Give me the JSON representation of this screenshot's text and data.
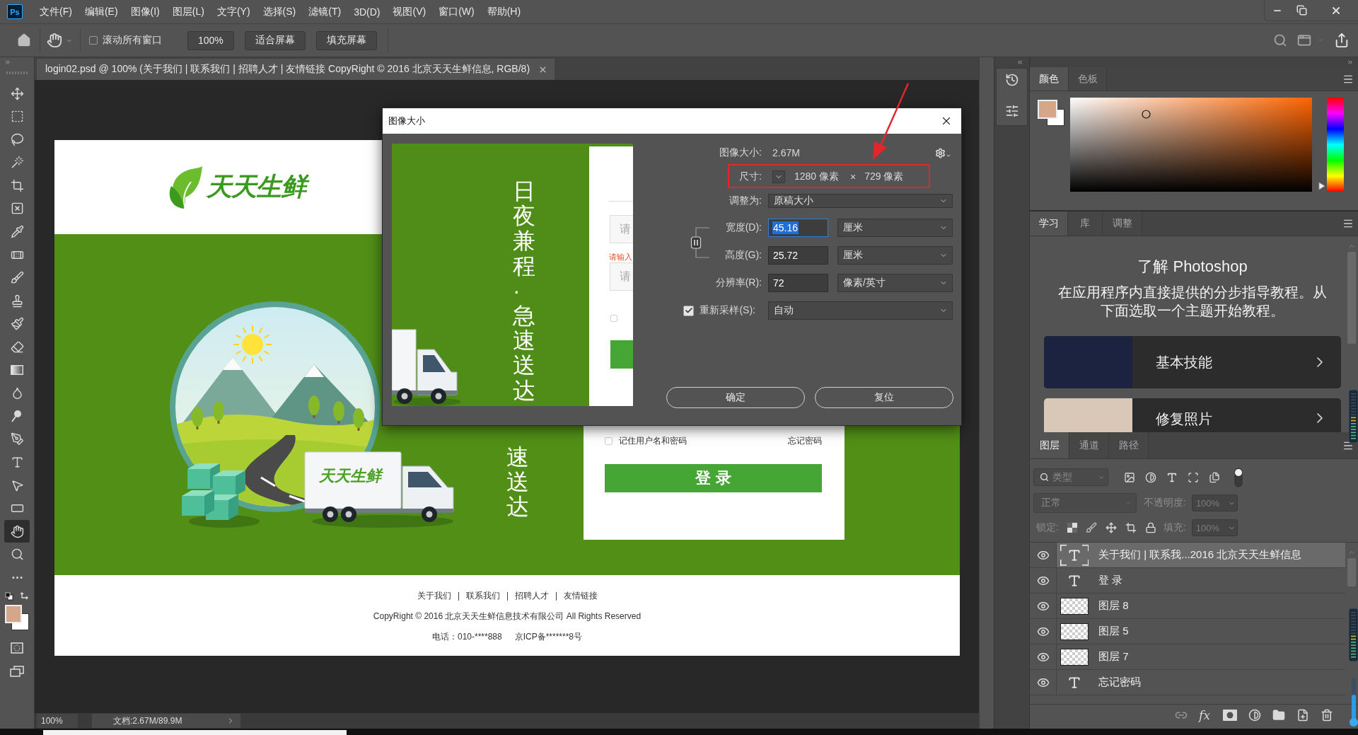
{
  "menu_bar": {
    "logo": "Ps",
    "items": [
      "文件(F)",
      "编辑(E)",
      "图像(I)",
      "图层(L)",
      "文字(Y)",
      "选择(S)",
      "滤镜(T)",
      "3D(D)",
      "视图(V)",
      "窗口(W)",
      "帮助(H)"
    ]
  },
  "options_bar": {
    "scroll_all": {
      "label": "滚动所有窗口",
      "checked": false
    },
    "buttons": [
      "100%",
      "适合屏幕",
      "填充屏幕"
    ]
  },
  "toolbar": {
    "tools": [
      {
        "selected": false
      },
      {
        "selected": false
      },
      {
        "selected": false
      },
      {
        "selected": false
      },
      {
        "selected": false
      },
      {
        "selected": false
      },
      {
        "selected": false
      },
      {
        "selected": false
      },
      {
        "selected": false
      },
      {
        "selected": false
      },
      {
        "selected": false
      },
      {
        "selected": false
      },
      {
        "selected": false
      },
      {
        "selected": false
      },
      {
        "selected": false
      },
      {
        "selected": false
      },
      {
        "selected": false
      },
      {
        "selected": false
      },
      {
        "selected": false
      },
      {
        "selected": true
      },
      {
        "selected": false
      },
      {
        "selected": false
      }
    ]
  },
  "document_tab": {
    "title": "login02.psd @ 100% (关于我们 | 联系我们 | 招聘人才 | 友情链接 CopyRight © 2016 北京天天生鲜信息, RGB/8)"
  },
  "canvas_document": {
    "logo": "天天生鲜",
    "slogan": "速送达",
    "truck_logo": "天天生鲜",
    "login_card": {
      "remember": {
        "label": "记住用户名和密码",
        "checked": false
      },
      "forgot": "忘记密码",
      "login_button": "登 录"
    },
    "footer": {
      "links": [
        "关于我们",
        "联系我们",
        "招聘人才",
        "友情链接"
      ],
      "copyright": "CopyRight © 2016 北京天天生鲜信息技术有限公司 All Rights Reserved",
      "phone": "电话：010-****888",
      "icp": "京ICP备*******8号"
    }
  },
  "dialog": {
    "title": "图像大小",
    "preview": {
      "slogan": "日夜兼程·急速送达",
      "fields": [
        {
          "placeholder": "请"
        },
        {
          "placeholder": "请"
        }
      ],
      "error": "请输入",
      "remember_checked": false
    },
    "image_size": {
      "label": "图像大小:",
      "value": "2.67M"
    },
    "dimensions": {
      "label": "尺寸:",
      "width": "1280 像素",
      "times": "×",
      "height": "729 像素"
    },
    "fit_to": {
      "label": "调整为:",
      "value": "原稿大小"
    },
    "fields": [
      {
        "label": "宽度(D):",
        "value": "45.16",
        "unit": "厘米",
        "focused": true
      },
      {
        "label": "高度(G):",
        "value": "25.72",
        "unit": "厘米",
        "focused": false
      },
      {
        "label": "分辨率(R):",
        "value": "72",
        "unit": "像素/英寸",
        "focused": false
      }
    ],
    "resample": {
      "label": "重新采样(S):",
      "checked": true,
      "value": "自动"
    },
    "buttons": [
      "确定",
      "复位"
    ]
  },
  "color_panel": {
    "tabs": [
      {
        "label": "颜色",
        "selected": true
      },
      {
        "label": "色板",
        "selected": false
      }
    ],
    "hue": {
      "level": 0.06
    }
  },
  "learn_panel": {
    "tabs": [
      {
        "label": "学习",
        "selected": true
      },
      {
        "label": "库",
        "selected": false
      },
      {
        "label": "调整",
        "selected": false
      }
    ],
    "heading": "了解 Photoshop",
    "description": "在应用程序内直接提供的分步指导教程。从下面选取一个主题开始教程。",
    "topics": [
      "基本技能",
      "修复照片"
    ]
  },
  "layers_panel": {
    "tabs": [
      {
        "label": "图层",
        "selected": true
      },
      {
        "label": "通道",
        "selected": false
      },
      {
        "label": "路径",
        "selected": false
      }
    ],
    "filter": {
      "placeholder": "类型",
      "on": true
    },
    "controls_disabled": true,
    "blend_mode": "正常",
    "opacity_label": "不透明度:",
    "opacity": "100%",
    "lock_label": "锁定:",
    "fill_label": "填充:",
    "fill": "100%",
    "layers": [
      {
        "name": "关于我们 | 联系我...2016 北京天天生鲜信息",
        "kind": "text",
        "visible": true,
        "selected": true
      },
      {
        "name": "登 录",
        "kind": "text",
        "visible": true,
        "selected": false
      },
      {
        "name": "图层 8",
        "kind": "pixel",
        "visible": true,
        "selected": false
      },
      {
        "name": "图层 5",
        "kind": "pixel",
        "visible": true,
        "selected": false
      },
      {
        "name": "图层 7",
        "kind": "pixel",
        "visible": true,
        "selected": false
      },
      {
        "name": "忘记密码",
        "kind": "text",
        "visible": true,
        "selected": false
      }
    ],
    "effects_label": "fx"
  },
  "status_bar": {
    "zoom": "100%",
    "doc_info": "文档:2.67M/89.9M"
  }
}
